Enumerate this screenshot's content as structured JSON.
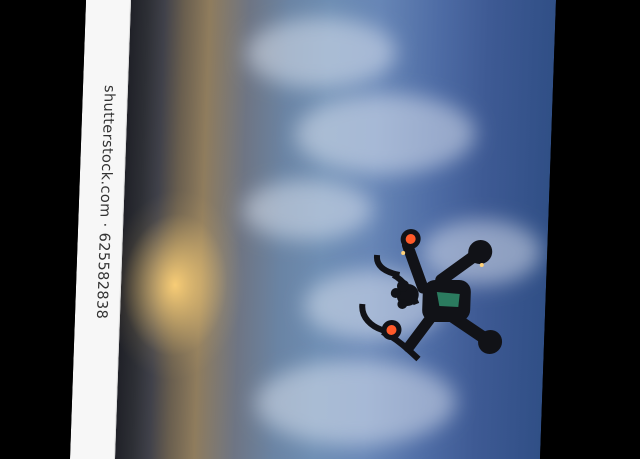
{
  "watermark": {
    "text": "shutterstock.com · 625582838"
  },
  "scene": {
    "subject": "drone",
    "colors": {
      "background": "#000000",
      "sky_blue": "#4e6ca5",
      "cloud_white": "#e6ecf5",
      "sunset_orange": "#ffd27a",
      "drone_dark": "#111217",
      "motor_led": "#ff5a2a",
      "watermark_strip": "#f7f7f7",
      "watermark_text": "#333333"
    }
  }
}
